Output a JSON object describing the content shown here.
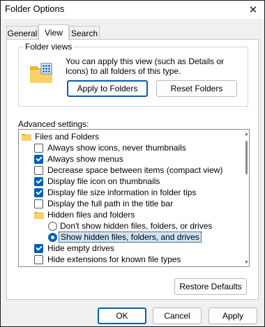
{
  "window": {
    "title": "Folder Options",
    "close_glyph": "✕"
  },
  "tabs": [
    {
      "label": "General",
      "active": false
    },
    {
      "label": "View",
      "active": true
    },
    {
      "label": "Search",
      "active": false
    }
  ],
  "folder_views": {
    "label": "Folder views",
    "description": "You can apply this view (such as Details or Icons) to all folders of this type.",
    "apply_button": "Apply to Folders",
    "reset_button": "Reset Folders",
    "icon": "folder-grid-icon"
  },
  "advanced": {
    "label": "Advanced settings:",
    "items": [
      {
        "type": "folder",
        "label": "Files and Folders"
      },
      {
        "type": "checkbox",
        "label": "Always show icons, never thumbnails",
        "checked": false
      },
      {
        "type": "checkbox",
        "label": "Always show menus",
        "checked": true
      },
      {
        "type": "checkbox",
        "label": "Decrease space between items (compact view)",
        "checked": false
      },
      {
        "type": "checkbox",
        "label": "Display file icon on thumbnails",
        "checked": true
      },
      {
        "type": "checkbox",
        "label": "Display file size information in folder tips",
        "checked": true
      },
      {
        "type": "checkbox",
        "label": "Display the full path in the title bar",
        "checked": false
      },
      {
        "type": "folder",
        "label": "Hidden files and folders"
      },
      {
        "type": "radio",
        "label": "Don't show hidden files, folders, or drives",
        "selected": false
      },
      {
        "type": "radio",
        "label": "Show hidden files, folders, and drives",
        "selected": true
      },
      {
        "type": "checkbox",
        "label": "Hide empty drives",
        "checked": true
      },
      {
        "type": "checkbox",
        "label": "Hide extensions for known file types",
        "checked": false
      }
    ]
  },
  "restore_defaults": "Restore Defaults",
  "footer": {
    "ok": "OK",
    "cancel": "Cancel",
    "apply": "Apply"
  },
  "colors": {
    "accent": "#005fb8",
    "selection": "#cce4f7",
    "folder": "#f4c542"
  }
}
